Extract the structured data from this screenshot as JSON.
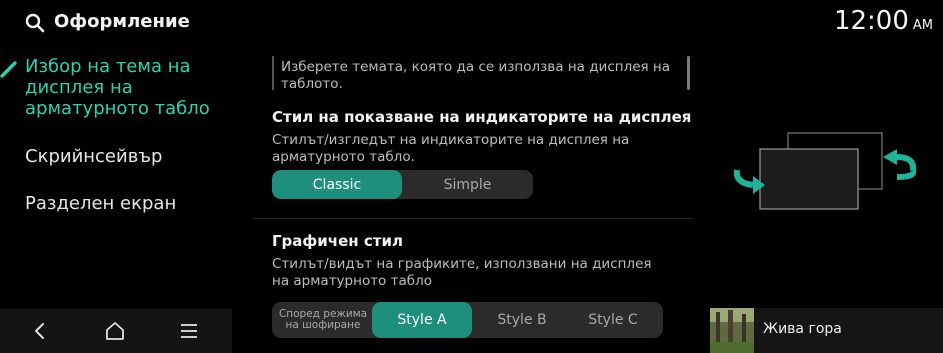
{
  "header": {
    "title": "Оформление",
    "time": "12:00",
    "ampm": "AM",
    "search_icon": "search-icon"
  },
  "menu": {
    "items": [
      {
        "label": "Избор на тема на дисплея на арматурното табло",
        "active": true
      },
      {
        "label": "Скрийнсейвър",
        "active": false
      },
      {
        "label": "Разделен екран",
        "active": false
      }
    ],
    "accent_color": "#2ad4b2"
  },
  "bottom_nav": {
    "icons": [
      "back-icon",
      "home-icon",
      "menu-icon"
    ]
  },
  "main": {
    "intro": "Изберете темата, която да се използва на дисплея на таблото.",
    "indicator_section": {
      "title": "Стил на показване на индикаторите на дисплея",
      "description": "Стилът/изгледът на индикаторите на дисплея на арматурното табло.",
      "options": [
        "Classic",
        "Simple"
      ],
      "selected": "Classic"
    },
    "graphic_section": {
      "title": "Графичен стил",
      "description": "Стилът/видът на графиките, използвани на дисплея на арматурното табло",
      "options": [
        "Според режима на шофиране",
        "Style A",
        "Style B",
        "Style C"
      ],
      "selected": "Style A"
    },
    "selected_color": "#1e8f7c"
  },
  "media": {
    "title": "Жива гора"
  }
}
